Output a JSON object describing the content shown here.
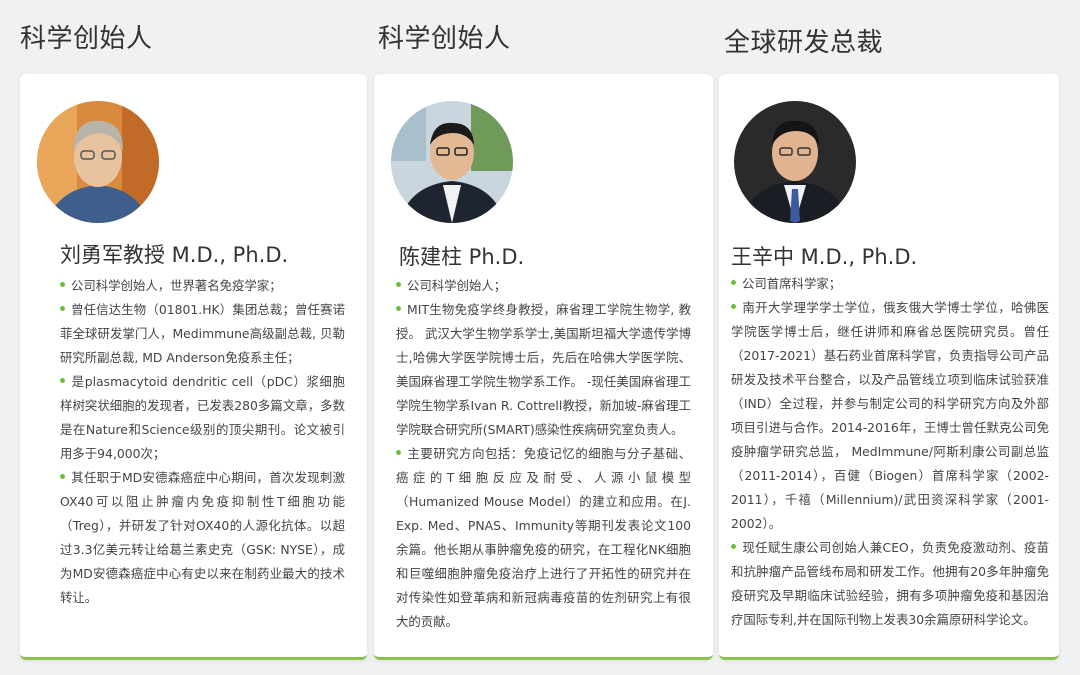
{
  "columns": [
    {
      "heading": "科学创始人",
      "name": "刘勇军教授 M.D., Ph.D.",
      "bullets": [
        "公司科学创始人，世界著名免疫学家；",
        "曾任信达生物（01801.HK）集团总裁；曾任赛诺菲全球研发掌门人，Medimmune高级副总裁, 贝勒研究所副总裁, MD Anderson免疫系主任；",
        "是plasmacytoid dendritic cell（pDC）浆细胞样树突状细胞的发现者，已发表280多篇文章，多数是在Nature和Science级别的顶尖期刊。论文被引用多于94,000次；",
        "其任职于MD安德森癌症中心期间，首次发现刺激OX40可以阻止肿瘤内免疫抑制性T细胞功能（Treg），并研发了针对OX40的人源化抗体。以超过3.3亿美元转让给葛兰素史克（GSK: NYSE），成为MD安德森癌症中心有史以来在制药业最大的技术转让。"
      ]
    },
    {
      "heading": "科学创始人",
      "name": "陈建柱 Ph.D.",
      "bullets": [
        "公司科学创始人；",
        "MIT生物免疫学终身教授，麻省理工学院生物学, 教授。 武汉大学生物学系学士,美国斯坦福大学遗传学博士,哈佛大学医学院博士后，先后在哈佛大学医学院、美国麻省理工学院生物学系工作。 -现任美国麻省理工学院生物学系Ivan R. Cottrell教授，新加坡-麻省理工学院联合研究所(SMART)感染性疾病研究室负责人。",
        "主要研究方向包括：免疫记忆的细胞与分子基础、癌症的T细胞反应及耐受、人源小鼠模型（Humanized Mouse Model）的建立和应用。在J. Exp. Med、PNAS、Immunity等期刊发表论文100余篇。他长期从事肿瘤免疫的研究，在工程化NK细胞和巨噬细胞肿瘤免疫治疗上进行了开拓性的研究并在对传染性如登革病和新冠病毒疫苗的佐剂研究上有很大的贡献。"
      ]
    },
    {
      "heading": "全球研发总裁",
      "name": "王辛中 M.D., Ph.D.",
      "bullets": [
        "公司首席科学家；",
        "南开大学理学学士学位，俄亥俄大学博士学位，哈佛医学院医学博士后，继任讲师和麻省总医院研究员。曾任（2017-2021）基石药业首席科学官，负责指导公司产品研发及技术平台整合，以及产品管线立项到临床试验获准（IND）全过程，并参与制定公司的科学研究方向及外部项目引进与合作。2014-2016年，王博士曾任默克公司免疫肿瘤学研究总监， MedImmune/阿斯利康公司副总监（2011-2014），百健（Biogen）首席科学家（2002-2011），千禧（Millennium)/武田资深科学家（2001-2002）。",
        "现任赋生康公司创始人兼CEO，负责免疫激动剂、疫苗和抗肿瘤产品管线布局和研发工作。他拥有20多年肿瘤免疫研究及早期临床试验经验，拥有多项肿瘤免疫和基因治疗国际专利,并在国际刊物上发表30余篇原研科学论文。"
      ]
    }
  ],
  "colors": {
    "accent": "#8bc34a",
    "bullet": "#6cbf3c",
    "background": "#f0f1f3"
  }
}
